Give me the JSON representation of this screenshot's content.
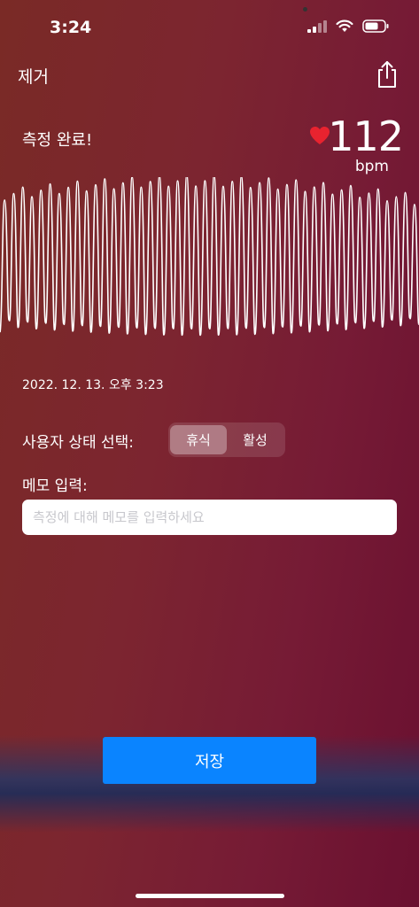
{
  "status_bar": {
    "time": "3:24"
  },
  "nav": {
    "left_label": "제거",
    "share_icon": "share-icon"
  },
  "measurement": {
    "status": "측정 완료!",
    "bpm_value": "112",
    "bpm_unit": "bpm",
    "heart_color": "#e8232f",
    "timestamp": "2022. 12. 13. 오후 3:23"
  },
  "user_state": {
    "label": "사용자 상태 선택:",
    "options": [
      "휴식",
      "활성"
    ],
    "selected": "휴식"
  },
  "memo": {
    "label": "메모 입력:",
    "placeholder": "측정에 대해 메모를 입력하세요",
    "value": ""
  },
  "save_button": {
    "label": "저장",
    "color": "#0a84ff"
  }
}
